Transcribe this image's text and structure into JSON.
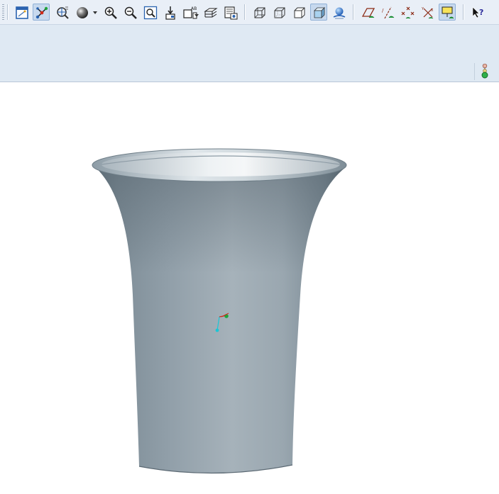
{
  "toolbar": {
    "groups": [
      {
        "name": "view",
        "buttons": [
          {
            "id": "repaint",
            "icon": "repaint-icon"
          },
          {
            "id": "spin-center",
            "icon": "spin-center-icon",
            "active": true
          },
          {
            "id": "orient-mode",
            "icon": "orient-mode-icon"
          },
          {
            "id": "appearance",
            "icon": "appearance-sphere-icon",
            "dropdown": true
          },
          {
            "id": "zoom-in",
            "icon": "zoom-in-icon"
          },
          {
            "id": "zoom-out",
            "icon": "zoom-out-icon"
          },
          {
            "id": "refit",
            "icon": "refit-icon"
          },
          {
            "id": "reorient",
            "icon": "reorient-icon"
          },
          {
            "id": "saved-views",
            "icon": "saved-views-icon",
            "dropdown": true
          },
          {
            "id": "layers",
            "icon": "layers-icon"
          },
          {
            "id": "view-manager",
            "icon": "view-manager-icon"
          }
        ]
      },
      {
        "name": "display-style",
        "buttons": [
          {
            "id": "wireframe",
            "icon": "wireframe-icon"
          },
          {
            "id": "hidden-line",
            "icon": "hidden-line-icon"
          },
          {
            "id": "no-hidden",
            "icon": "no-hidden-icon"
          },
          {
            "id": "shading",
            "icon": "shading-icon",
            "active": true
          },
          {
            "id": "enhanced-realism",
            "icon": "enhanced-realism-icon"
          }
        ]
      },
      {
        "name": "datum-display",
        "buttons": [
          {
            "id": "datum-planes",
            "icon": "datum-planes-icon"
          },
          {
            "id": "datum-axes",
            "icon": "datum-axes-icon"
          },
          {
            "id": "point-display",
            "icon": "point-display-icon"
          },
          {
            "id": "csys-display",
            "icon": "csys-display-icon"
          },
          {
            "id": "annotation-display",
            "icon": "annotation-display-icon",
            "active": true
          }
        ]
      },
      {
        "name": "help",
        "buttons": [
          {
            "id": "context-help",
            "icon": "context-help-icon"
          }
        ]
      }
    ]
  },
  "ribbon": {
    "status_icon": "traffic-light-icon"
  },
  "viewport": {
    "background": "#ffffff",
    "model": {
      "type": "flared-vase",
      "surface_color": "#8e9ea9",
      "highlight_color": "#c2ccd3"
    },
    "csys": {
      "x_color": "#d22a1a",
      "y_color": "#1fa43b",
      "z_color": "#1bc6d6"
    }
  },
  "colors": {
    "toolbar_bg": "#e9eff7",
    "ribbon_bg": "#dfe9f3",
    "active_button_bg": "#c7d9ee",
    "icon_blue": "#2a63b0"
  }
}
